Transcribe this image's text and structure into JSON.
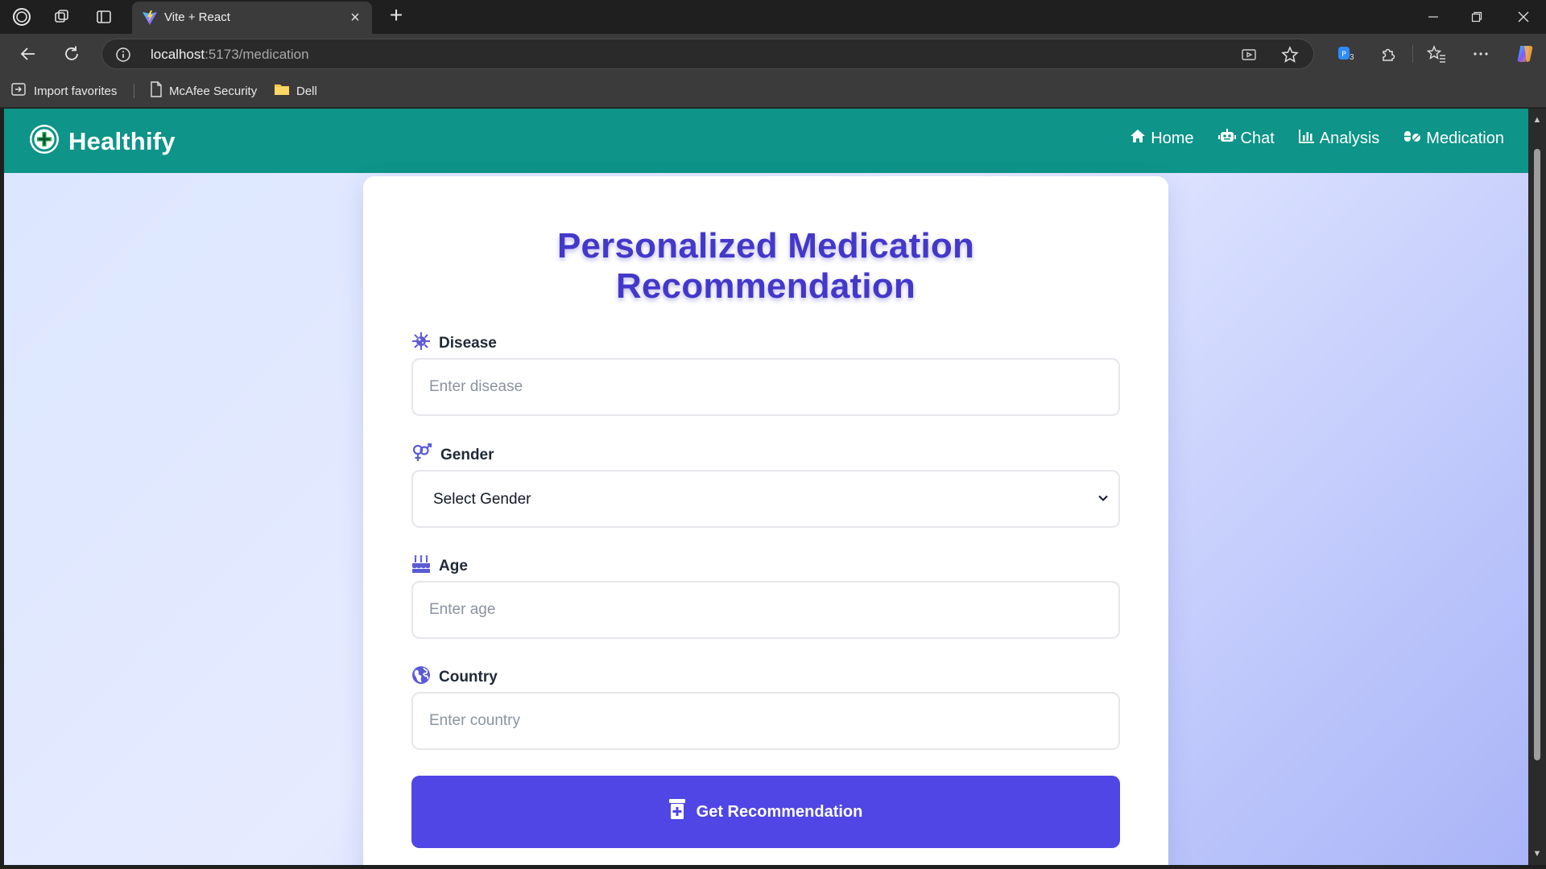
{
  "browser": {
    "tab_title": "Vite + React",
    "url_host": "localhost",
    "url_path": ":5173/medication",
    "bookmarks": [
      {
        "label": "Import favorites",
        "icon": "import-icon"
      },
      {
        "label": "McAfee Security",
        "icon": "page-icon"
      },
      {
        "label": "Dell",
        "icon": "folder-icon"
      }
    ],
    "extension_badge": "3"
  },
  "navbar": {
    "brand": "Healthify",
    "links": [
      {
        "label": "Home",
        "icon": "home-icon"
      },
      {
        "label": "Chat",
        "icon": "robot-icon"
      },
      {
        "label": "Analysis",
        "icon": "chart-icon"
      },
      {
        "label": "Medication",
        "icon": "pills-icon"
      }
    ]
  },
  "form": {
    "title_line1": "Personalized Medication",
    "title_line2": "Recommendation",
    "disease": {
      "label": "Disease",
      "placeholder": "Enter disease",
      "icon": "virus-icon"
    },
    "gender": {
      "label": "Gender",
      "selected": "Select Gender",
      "icon": "gender-icon"
    },
    "age": {
      "label": "Age",
      "placeholder": "Enter age",
      "icon": "birthday-cake-icon"
    },
    "country": {
      "label": "Country",
      "placeholder": "Enter country",
      "icon": "globe-icon"
    },
    "submit_label": "Get Recommendation"
  },
  "colors": {
    "navbar": "#0e9488",
    "title": "#4338ca",
    "button": "#4f46e5",
    "icon_accent": "#5b5bd6"
  }
}
